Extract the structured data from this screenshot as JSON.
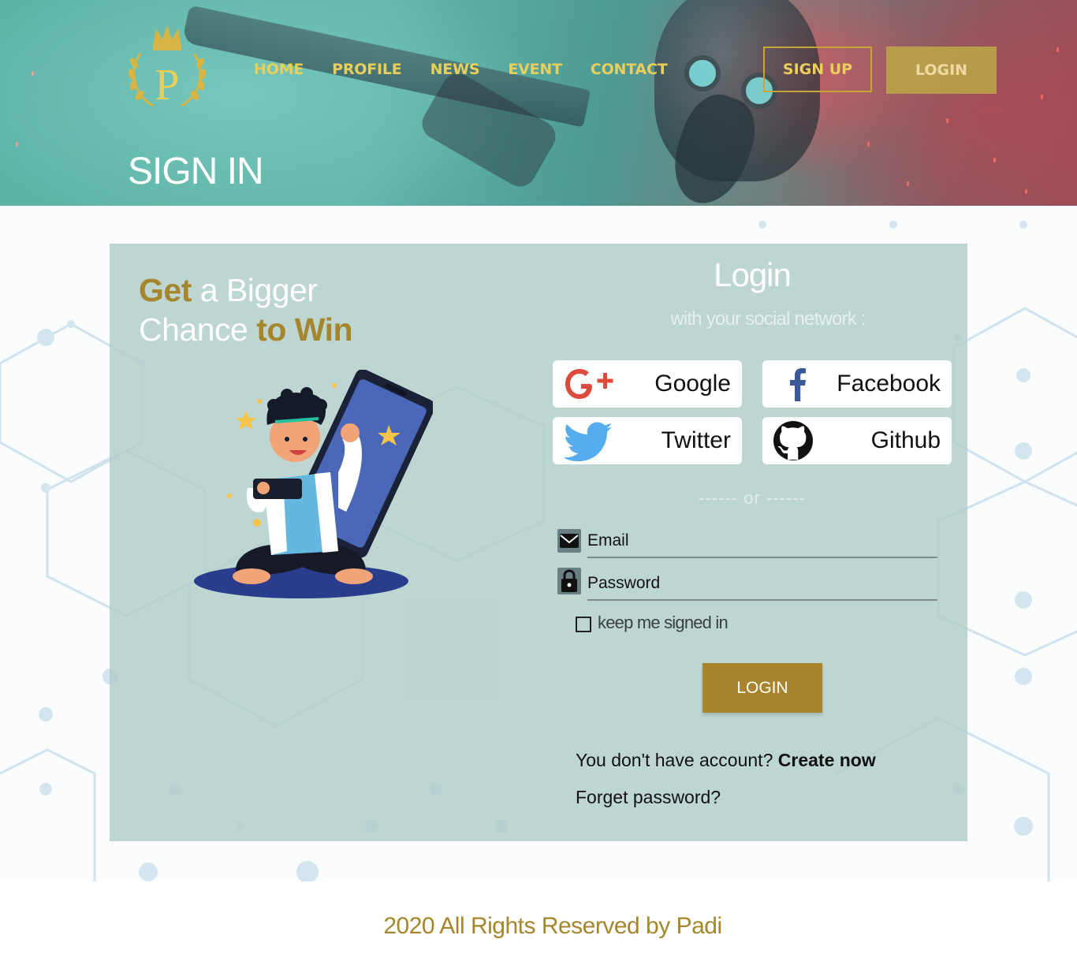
{
  "header": {
    "nav": [
      "HOME",
      "PROFILE",
      "NEWS",
      "EVENT",
      "CONTACT"
    ],
    "signup_label": "SIGN UP",
    "login_label": "LOGIN",
    "page_title": "SIGN IN",
    "logo_letter": "P"
  },
  "promo": {
    "line1_gold": "Get",
    "line1_rest": " a Bigger",
    "line2_plain": "Chance ",
    "line2_gold": "to Win"
  },
  "login_panel": {
    "title": "Login",
    "subtitle": "with your social network :",
    "social": {
      "google": "Google",
      "facebook": "Facebook",
      "twitter": "Twitter",
      "github": "Github"
    },
    "divider": "------ or ------",
    "email_label": "Email",
    "password_label": "Password",
    "remember_label": "keep me signed in",
    "remember_checked": false,
    "submit_label": "LOGIN",
    "no_account_text": "You don't have account?",
    "create_link": "Create now",
    "forget_link": "Forget password?"
  },
  "footer": {
    "text": "2020 All Rights Reserved by Padi"
  },
  "colors": {
    "gold": "#a8852c",
    "nav_gold": "#e9cf5a",
    "card_bg": "#b0cdc8"
  }
}
